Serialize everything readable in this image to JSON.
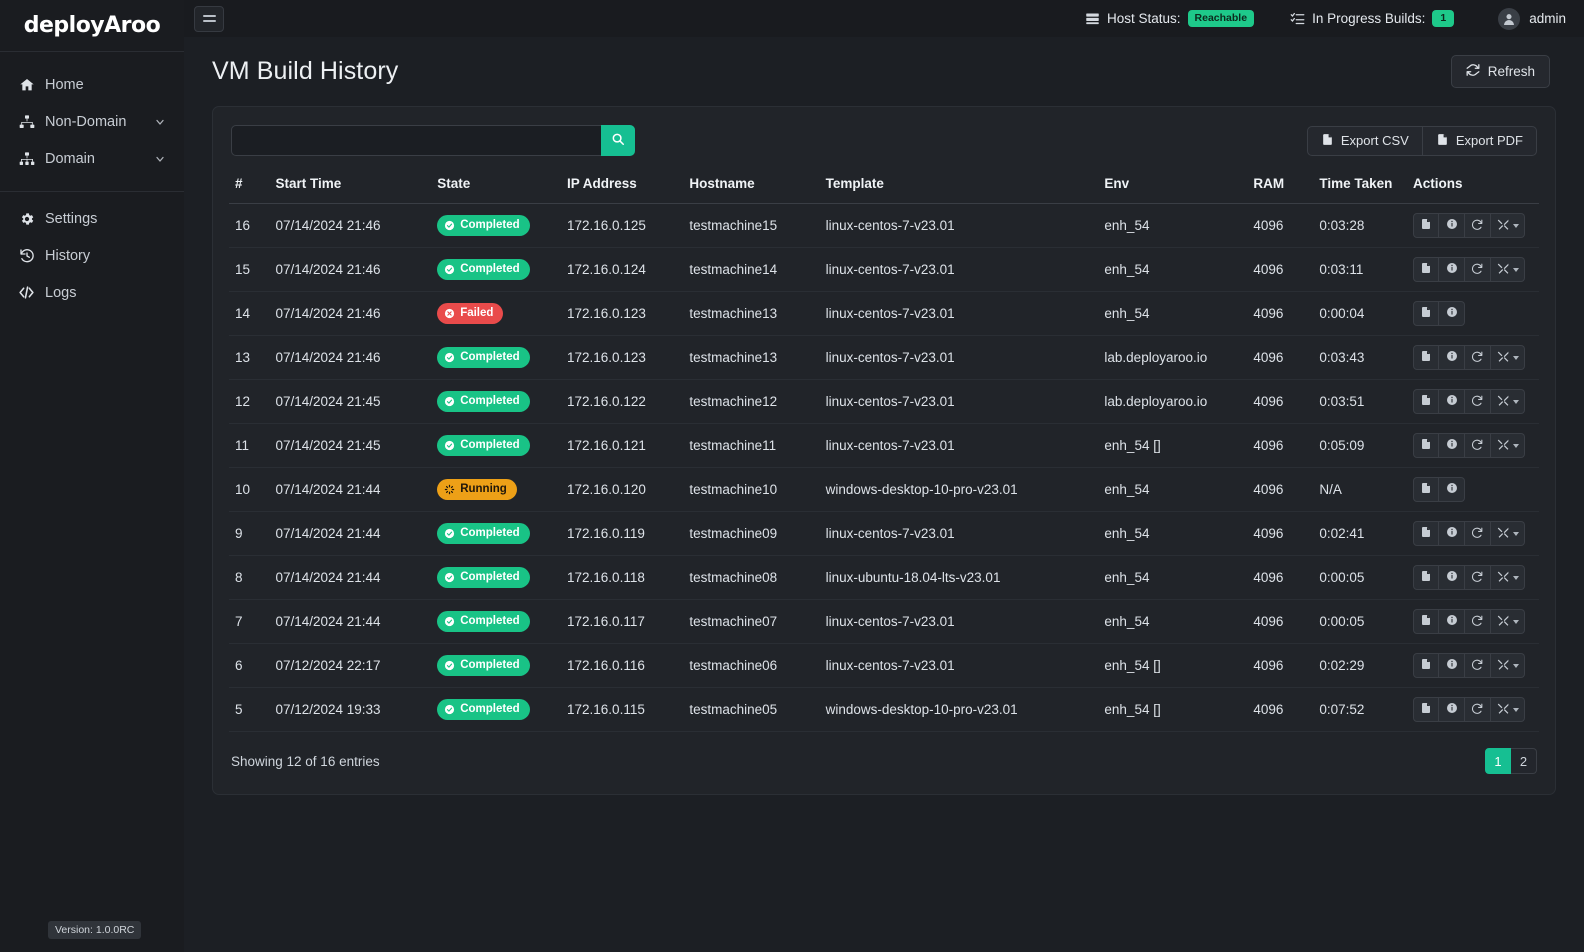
{
  "brand": {
    "name": "deployAroo",
    "version_label": "Version: 1.0.0RC"
  },
  "sidebar": {
    "items": [
      {
        "label": "Home",
        "icon": "home-icon",
        "expandable": false
      },
      {
        "label": "Non-Domain",
        "icon": "sitemap-icon",
        "expandable": true
      },
      {
        "label": "Domain",
        "icon": "hierarchy-icon",
        "expandable": true
      }
    ],
    "items2": [
      {
        "label": "Settings",
        "icon": "gear-icon"
      },
      {
        "label": "History",
        "icon": "history-icon"
      },
      {
        "label": "Logs",
        "icon": "code-icon"
      }
    ]
  },
  "topbar": {
    "menu_icon": "hamburger-icon",
    "host_status_label": "Host Status:",
    "host_status_value": "Reachable",
    "in_progress_label": "In Progress Builds:",
    "in_progress_value": "1",
    "user_name": "admin"
  },
  "header": {
    "title": "VM Build History",
    "refresh_label": "Refresh"
  },
  "search": {
    "value": "",
    "placeholder": ""
  },
  "export": {
    "csv_label": "Export CSV",
    "pdf_label": "Export PDF"
  },
  "table": {
    "columns": [
      "#",
      "Start Time",
      "State",
      "IP Address",
      "Hostname",
      "Template",
      "Env",
      "RAM",
      "Time Taken",
      "Actions"
    ],
    "rows": [
      {
        "idx": "16",
        "start": "07/14/2024 21:46",
        "state": "Completed",
        "ip": "172.16.0.125",
        "host": "testmachine15",
        "template": "linux-centos-7-v23.01",
        "env": "enh_54",
        "ram": "4096",
        "taken": "0:03:28",
        "actions": [
          "file",
          "info",
          "rebuild",
          "tools"
        ]
      },
      {
        "idx": "15",
        "start": "07/14/2024 21:46",
        "state": "Completed",
        "ip": "172.16.0.124",
        "host": "testmachine14",
        "template": "linux-centos-7-v23.01",
        "env": "enh_54",
        "ram": "4096",
        "taken": "0:03:11",
        "actions": [
          "file",
          "info",
          "rebuild",
          "tools"
        ]
      },
      {
        "idx": "14",
        "start": "07/14/2024 21:46",
        "state": "Failed",
        "ip": "172.16.0.123",
        "host": "testmachine13",
        "template": "linux-centos-7-v23.01",
        "env": "enh_54",
        "ram": "4096",
        "taken": "0:00:04",
        "actions": [
          "file",
          "info"
        ]
      },
      {
        "idx": "13",
        "start": "07/14/2024 21:46",
        "state": "Completed",
        "ip": "172.16.0.123",
        "host": "testmachine13",
        "template": "linux-centos-7-v23.01",
        "env": "lab.deployaroo.io",
        "ram": "4096",
        "taken": "0:03:43",
        "actions": [
          "file",
          "info",
          "rebuild",
          "tools"
        ]
      },
      {
        "idx": "12",
        "start": "07/14/2024 21:45",
        "state": "Completed",
        "ip": "172.16.0.122",
        "host": "testmachine12",
        "template": "linux-centos-7-v23.01",
        "env": "lab.deployaroo.io",
        "ram": "4096",
        "taken": "0:03:51",
        "actions": [
          "file",
          "info",
          "rebuild",
          "tools"
        ]
      },
      {
        "idx": "11",
        "start": "07/14/2024 21:45",
        "state": "Completed",
        "ip": "172.16.0.121",
        "host": "testmachine11",
        "template": "linux-centos-7-v23.01",
        "env": "enh_54 []",
        "ram": "4096",
        "taken": "0:05:09",
        "actions": [
          "file",
          "info",
          "rebuild",
          "tools"
        ]
      },
      {
        "idx": "10",
        "start": "07/14/2024 21:44",
        "state": "Running",
        "ip": "172.16.0.120",
        "host": "testmachine10",
        "template": "windows-desktop-10-pro-v23.01",
        "env": "enh_54",
        "ram": "4096",
        "taken": "N/A",
        "actions": [
          "file",
          "info"
        ]
      },
      {
        "idx": "9",
        "start": "07/14/2024 21:44",
        "state": "Completed",
        "ip": "172.16.0.119",
        "host": "testmachine09",
        "template": "linux-centos-7-v23.01",
        "env": "enh_54",
        "ram": "4096",
        "taken": "0:02:41",
        "actions": [
          "file",
          "info",
          "rebuild",
          "tools"
        ]
      },
      {
        "idx": "8",
        "start": "07/14/2024 21:44",
        "state": "Completed",
        "ip": "172.16.0.118",
        "host": "testmachine08",
        "template": "linux-ubuntu-18.04-lts-v23.01",
        "env": "enh_54",
        "ram": "4096",
        "taken": "0:00:05",
        "actions": [
          "file",
          "info",
          "rebuild",
          "tools"
        ]
      },
      {
        "idx": "7",
        "start": "07/14/2024 21:44",
        "state": "Completed",
        "ip": "172.16.0.117",
        "host": "testmachine07",
        "template": "linux-centos-7-v23.01",
        "env": "enh_54",
        "ram": "4096",
        "taken": "0:00:05",
        "actions": [
          "file",
          "info",
          "rebuild",
          "tools"
        ]
      },
      {
        "idx": "6",
        "start": "07/12/2024 22:17",
        "state": "Completed",
        "ip": "172.16.0.116",
        "host": "testmachine06",
        "template": "linux-centos-7-v23.01",
        "env": "enh_54 []",
        "ram": "4096",
        "taken": "0:02:29",
        "actions": [
          "file",
          "info",
          "rebuild",
          "tools"
        ]
      },
      {
        "idx": "5",
        "start": "07/12/2024 19:33",
        "state": "Completed",
        "ip": "172.16.0.115",
        "host": "testmachine05",
        "template": "windows-desktop-10-pro-v23.01",
        "env": "enh_54 []",
        "ram": "4096",
        "taken": "0:07:52",
        "actions": [
          "file",
          "info",
          "rebuild",
          "tools"
        ]
      }
    ]
  },
  "footer": {
    "showing_text": "Showing 12 of 16 entries",
    "pages": [
      "1",
      "2"
    ],
    "active_page": "1"
  },
  "colors": {
    "accent": "#16bf92",
    "success": "#19c386",
    "danger": "#e94b4b",
    "warning": "#eda017",
    "highlight": "#d633e0"
  }
}
